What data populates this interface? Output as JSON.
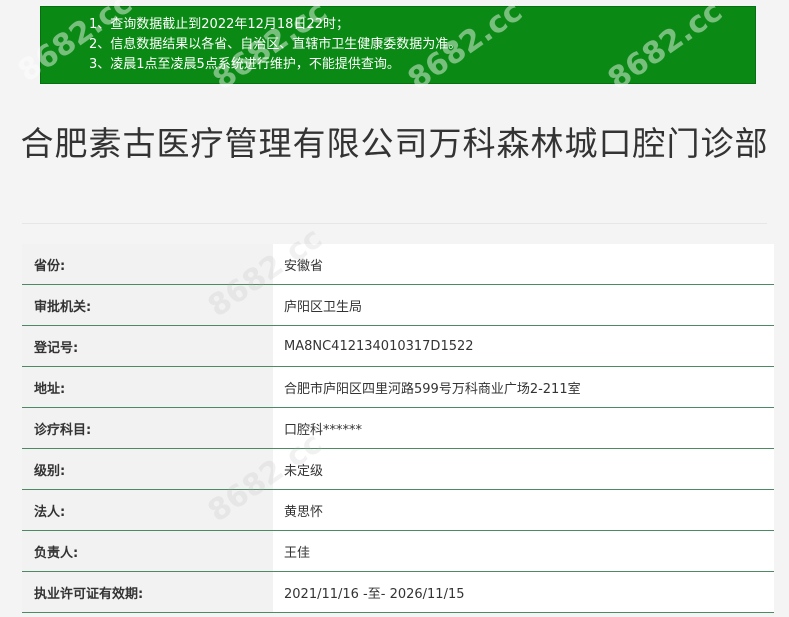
{
  "notice": {
    "lines": [
      "1、查询数据截止到2022年12月18日22时；",
      "2、信息数据结果以各省、自治区、直辖市卫生健康委数据为准。",
      "3、凌晨1点至凌晨5点系统进行维护，不能提供查询。"
    ]
  },
  "title": "合肥素古医疗管理有限公司万科森林城口腔门诊部",
  "rows": [
    {
      "label": "省份:",
      "value": "安徽省"
    },
    {
      "label": "审批机关:",
      "value": "庐阳区卫生局"
    },
    {
      "label": "登记号:",
      "value": "MA8NC412134010317D1522"
    },
    {
      "label": "地址:",
      "value": "合肥市庐阳区四里河路599号万科商业广场2-211室"
    },
    {
      "label": "诊疗科目:",
      "value": "口腔科******"
    },
    {
      "label": "级别:",
      "value": "未定级"
    },
    {
      "label": "法人:",
      "value": "黄思怀"
    },
    {
      "label": "负责人:",
      "value": "王佳"
    },
    {
      "label": "执业许可证有效期:",
      "value": "2021/11/16 -至- 2026/11/15"
    }
  ],
  "watermark": "8682.cc",
  "colors": {
    "notice_bg": "#0a8a14",
    "row_border": "#4b8a64",
    "label_bg": "#f2f2f2"
  }
}
